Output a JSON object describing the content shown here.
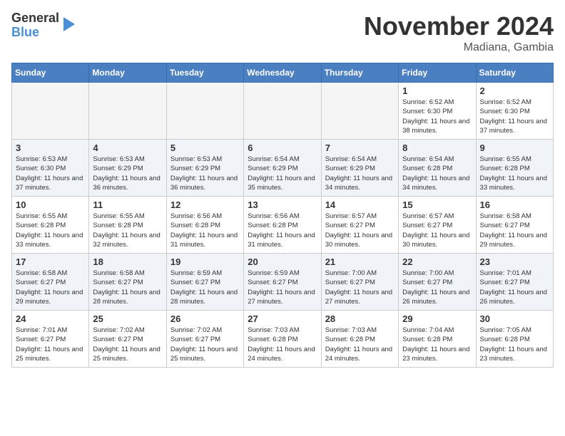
{
  "header": {
    "logo_line1": "General",
    "logo_line2": "Blue",
    "month_title": "November 2024",
    "location": "Madiana, Gambia"
  },
  "weekdays": [
    "Sunday",
    "Monday",
    "Tuesday",
    "Wednesday",
    "Thursday",
    "Friday",
    "Saturday"
  ],
  "weeks": [
    [
      {
        "day": "",
        "info": ""
      },
      {
        "day": "",
        "info": ""
      },
      {
        "day": "",
        "info": ""
      },
      {
        "day": "",
        "info": ""
      },
      {
        "day": "",
        "info": ""
      },
      {
        "day": "1",
        "info": "Sunrise: 6:52 AM\nSunset: 6:30 PM\nDaylight: 11 hours and 38 minutes."
      },
      {
        "day": "2",
        "info": "Sunrise: 6:52 AM\nSunset: 6:30 PM\nDaylight: 11 hours and 37 minutes."
      }
    ],
    [
      {
        "day": "3",
        "info": "Sunrise: 6:53 AM\nSunset: 6:30 PM\nDaylight: 11 hours and 37 minutes."
      },
      {
        "day": "4",
        "info": "Sunrise: 6:53 AM\nSunset: 6:29 PM\nDaylight: 11 hours and 36 minutes."
      },
      {
        "day": "5",
        "info": "Sunrise: 6:53 AM\nSunset: 6:29 PM\nDaylight: 11 hours and 36 minutes."
      },
      {
        "day": "6",
        "info": "Sunrise: 6:54 AM\nSunset: 6:29 PM\nDaylight: 11 hours and 35 minutes."
      },
      {
        "day": "7",
        "info": "Sunrise: 6:54 AM\nSunset: 6:29 PM\nDaylight: 11 hours and 34 minutes."
      },
      {
        "day": "8",
        "info": "Sunrise: 6:54 AM\nSunset: 6:28 PM\nDaylight: 11 hours and 34 minutes."
      },
      {
        "day": "9",
        "info": "Sunrise: 6:55 AM\nSunset: 6:28 PM\nDaylight: 11 hours and 33 minutes."
      }
    ],
    [
      {
        "day": "10",
        "info": "Sunrise: 6:55 AM\nSunset: 6:28 PM\nDaylight: 11 hours and 33 minutes."
      },
      {
        "day": "11",
        "info": "Sunrise: 6:55 AM\nSunset: 6:28 PM\nDaylight: 11 hours and 32 minutes."
      },
      {
        "day": "12",
        "info": "Sunrise: 6:56 AM\nSunset: 6:28 PM\nDaylight: 11 hours and 31 minutes."
      },
      {
        "day": "13",
        "info": "Sunrise: 6:56 AM\nSunset: 6:28 PM\nDaylight: 11 hours and 31 minutes."
      },
      {
        "day": "14",
        "info": "Sunrise: 6:57 AM\nSunset: 6:27 PM\nDaylight: 11 hours and 30 minutes."
      },
      {
        "day": "15",
        "info": "Sunrise: 6:57 AM\nSunset: 6:27 PM\nDaylight: 11 hours and 30 minutes."
      },
      {
        "day": "16",
        "info": "Sunrise: 6:58 AM\nSunset: 6:27 PM\nDaylight: 11 hours and 29 minutes."
      }
    ],
    [
      {
        "day": "17",
        "info": "Sunrise: 6:58 AM\nSunset: 6:27 PM\nDaylight: 11 hours and 29 minutes."
      },
      {
        "day": "18",
        "info": "Sunrise: 6:58 AM\nSunset: 6:27 PM\nDaylight: 11 hours and 28 minutes."
      },
      {
        "day": "19",
        "info": "Sunrise: 6:59 AM\nSunset: 6:27 PM\nDaylight: 11 hours and 28 minutes."
      },
      {
        "day": "20",
        "info": "Sunrise: 6:59 AM\nSunset: 6:27 PM\nDaylight: 11 hours and 27 minutes."
      },
      {
        "day": "21",
        "info": "Sunrise: 7:00 AM\nSunset: 6:27 PM\nDaylight: 11 hours and 27 minutes."
      },
      {
        "day": "22",
        "info": "Sunrise: 7:00 AM\nSunset: 6:27 PM\nDaylight: 11 hours and 26 minutes."
      },
      {
        "day": "23",
        "info": "Sunrise: 7:01 AM\nSunset: 6:27 PM\nDaylight: 11 hours and 26 minutes."
      }
    ],
    [
      {
        "day": "24",
        "info": "Sunrise: 7:01 AM\nSunset: 6:27 PM\nDaylight: 11 hours and 25 minutes."
      },
      {
        "day": "25",
        "info": "Sunrise: 7:02 AM\nSunset: 6:27 PM\nDaylight: 11 hours and 25 minutes."
      },
      {
        "day": "26",
        "info": "Sunrise: 7:02 AM\nSunset: 6:27 PM\nDaylight: 11 hours and 25 minutes."
      },
      {
        "day": "27",
        "info": "Sunrise: 7:03 AM\nSunset: 6:28 PM\nDaylight: 11 hours and 24 minutes."
      },
      {
        "day": "28",
        "info": "Sunrise: 7:03 AM\nSunset: 6:28 PM\nDaylight: 11 hours and 24 minutes."
      },
      {
        "day": "29",
        "info": "Sunrise: 7:04 AM\nSunset: 6:28 PM\nDaylight: 11 hours and 23 minutes."
      },
      {
        "day": "30",
        "info": "Sunrise: 7:05 AM\nSunset: 6:28 PM\nDaylight: 11 hours and 23 minutes."
      }
    ]
  ]
}
